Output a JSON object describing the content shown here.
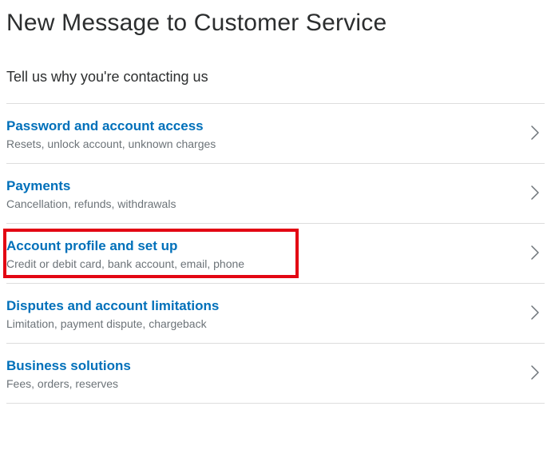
{
  "page_title": "New Message to Customer Service",
  "subtitle": "Tell us why you're contacting us",
  "categories": [
    {
      "title": "Password and account access",
      "desc": "Resets, unlock account, unknown charges",
      "highlighted": false
    },
    {
      "title": "Payments",
      "desc": "Cancellation, refunds, withdrawals",
      "highlighted": false
    },
    {
      "title": "Account profile and set up",
      "desc": "Credit or debit card, bank account, email, phone",
      "highlighted": true
    },
    {
      "title": "Disputes and account limitations",
      "desc": "Limitation, payment dispute, chargeback",
      "highlighted": false
    },
    {
      "title": "Business solutions",
      "desc": "Fees, orders, reserves",
      "highlighted": false
    }
  ]
}
